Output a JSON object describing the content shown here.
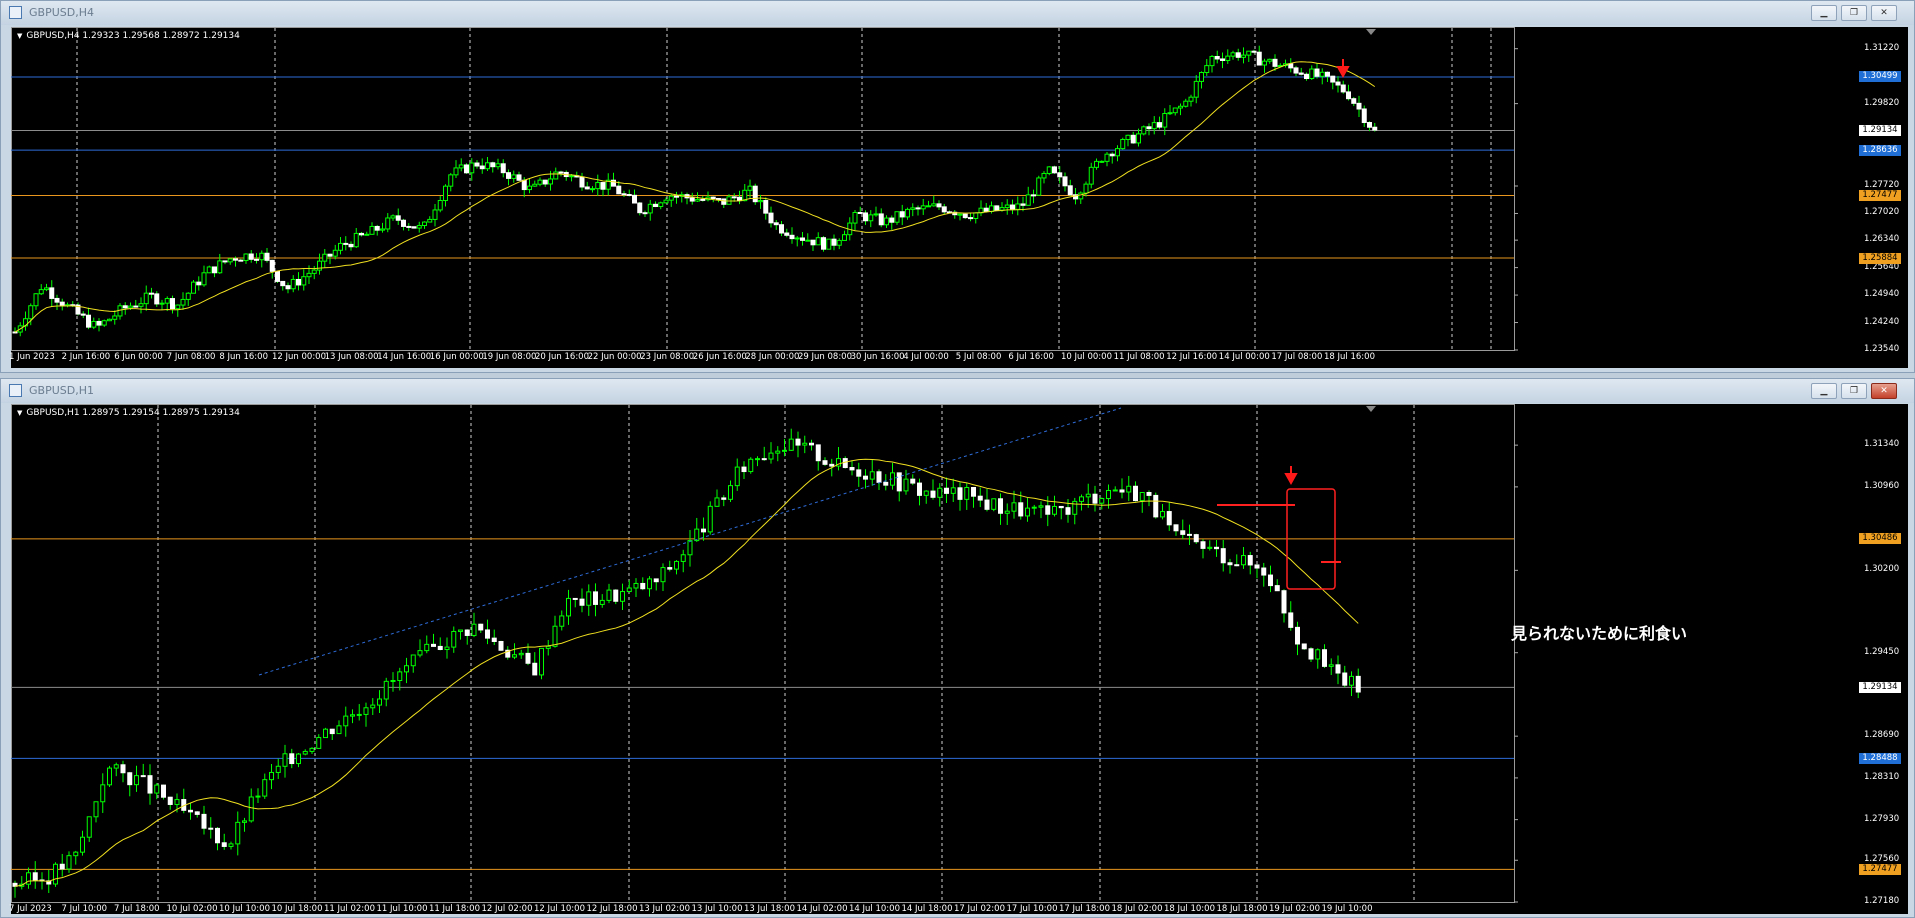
{
  "top": {
    "title": "GBPUSD,H4",
    "info": "GBPUSD,H4  1.29323 1.29568 1.28972 1.29134",
    "yrange": [
      1.2354,
      1.3162
    ],
    "yticks": [
      "1.31220",
      "1.29820",
      "1.27720",
      "1.27020",
      "1.26340",
      "1.25640",
      "1.24940",
      "1.24240",
      "1.23540"
    ],
    "levels": [
      {
        "label": "1.30499",
        "color": "#2e6cd8",
        "text": "#ffffff",
        "bg": "#1f6fd6"
      },
      {
        "label": "1.29134",
        "color": "#8c8c8c",
        "text": "#000000",
        "bg": "#ffffff"
      },
      {
        "label": "1.28636",
        "color": "#2e6cd8",
        "text": "#ffffff",
        "bg": "#1f6fd6"
      },
      {
        "label": "1.27477",
        "color": "#e8961e",
        "text": "#000000",
        "bg": "#f0a020"
      },
      {
        "label": "1.25884",
        "color": "#e8961e",
        "text": "#000000",
        "bg": "#f0a020"
      }
    ],
    "xlabels": [
      "1 Jun 2023",
      "2 Jun 16:00",
      "6 Jun 00:00",
      "7 Jun 08:00",
      "8 Jun 16:00",
      "12 Jun 00:00",
      "13 Jun 08:00",
      "14 Jun 16:00",
      "16 Jun 00:00",
      "19 Jun 08:00",
      "20 Jun 16:00",
      "22 Jun 00:00",
      "23 Jun 08:00",
      "26 Jun 16:00",
      "28 Jun 00:00",
      "29 Jun 08:00",
      "30 Jun 16:00",
      "4 Jul 00:00",
      "5 Jul 08:00",
      "6 Jul 16:00",
      "10 Jul 00:00",
      "11 Jul 08:00",
      "12 Jul 16:00",
      "14 Jul 00:00",
      "17 Jul 08:00",
      "18 Jul 16:00"
    ],
    "price_path": [
      1.24,
      1.252,
      1.246,
      1.241,
      1.246,
      1.249,
      1.247,
      1.255,
      1.259,
      1.26,
      1.251,
      1.256,
      1.262,
      1.265,
      1.269,
      1.266,
      1.28,
      1.283,
      1.281,
      1.276,
      1.281,
      1.278,
      1.277,
      1.271,
      1.275,
      1.274,
      1.273,
      1.276,
      1.267,
      1.264,
      1.262,
      1.27,
      1.268,
      1.271,
      1.272,
      1.27,
      1.271,
      1.272,
      1.281,
      1.275,
      1.285,
      1.289,
      1.293,
      1.298,
      1.31,
      1.311,
      1.309,
      1.307,
      1.305,
      1.301,
      1.291
    ]
  },
  "bottom": {
    "title": "GBPUSD,H1",
    "info": "GBPUSD,H1  1.28975 1.29154 1.28975 1.29134",
    "yrange": [
      1.2718,
      1.3166
    ],
    "yticks": [
      "1.31340",
      "1.30960",
      "1.30200",
      "1.29450",
      "1.28690",
      "1.28310",
      "1.27930",
      "1.27560",
      "1.27180"
    ],
    "levels": [
      {
        "label": "1.30486",
        "color": "#e8961e",
        "text": "#000000",
        "bg": "#f0a020"
      },
      {
        "label": "1.29134",
        "color": "#8c8c8c",
        "text": "#000000",
        "bg": "#ffffff"
      },
      {
        "label": "1.28488",
        "color": "#2e6cd8",
        "text": "#ffffff",
        "bg": "#1f6fd6"
      },
      {
        "label": "1.27477",
        "color": "#e8961e",
        "text": "#000000",
        "bg": "#f0a020"
      }
    ],
    "xlabels": [
      "7 Jul 2023",
      "7 Jul 10:00",
      "7 Jul 18:00",
      "10 Jul 02:00",
      "10 Jul 10:00",
      "10 Jul 18:00",
      "11 Jul 02:00",
      "11 Jul 10:00",
      "11 Jul 18:00",
      "12 Jul 02:00",
      "12 Jul 10:00",
      "12 Jul 18:00",
      "13 Jul 02:00",
      "13 Jul 10:00",
      "13 Jul 18:00",
      "14 Jul 02:00",
      "14 Jul 10:00",
      "14 Jul 18:00",
      "17 Jul 02:00",
      "17 Jul 10:00",
      "17 Jul 18:00",
      "18 Jul 02:00",
      "18 Jul 10:00",
      "18 Jul 18:00",
      "19 Jul 02:00",
      "19 Jul 10:00"
    ],
    "price_path": [
      1.2735,
      1.274,
      1.276,
      1.284,
      1.283,
      1.281,
      1.279,
      1.277,
      1.282,
      1.285,
      1.287,
      1.289,
      1.291,
      1.2935,
      1.2955,
      1.297,
      1.295,
      1.293,
      1.299,
      1.2995,
      1.3,
      1.301,
      1.304,
      1.308,
      1.312,
      1.3135,
      1.313,
      1.3115,
      1.311,
      1.31,
      1.309,
      1.309,
      1.308,
      1.3075,
      1.307,
      1.3085,
      1.3095,
      1.309,
      1.305,
      1.304,
      1.303,
      1.302,
      1.296,
      1.293,
      1.2913
    ],
    "annotation": "見られないために利食い"
  }
}
